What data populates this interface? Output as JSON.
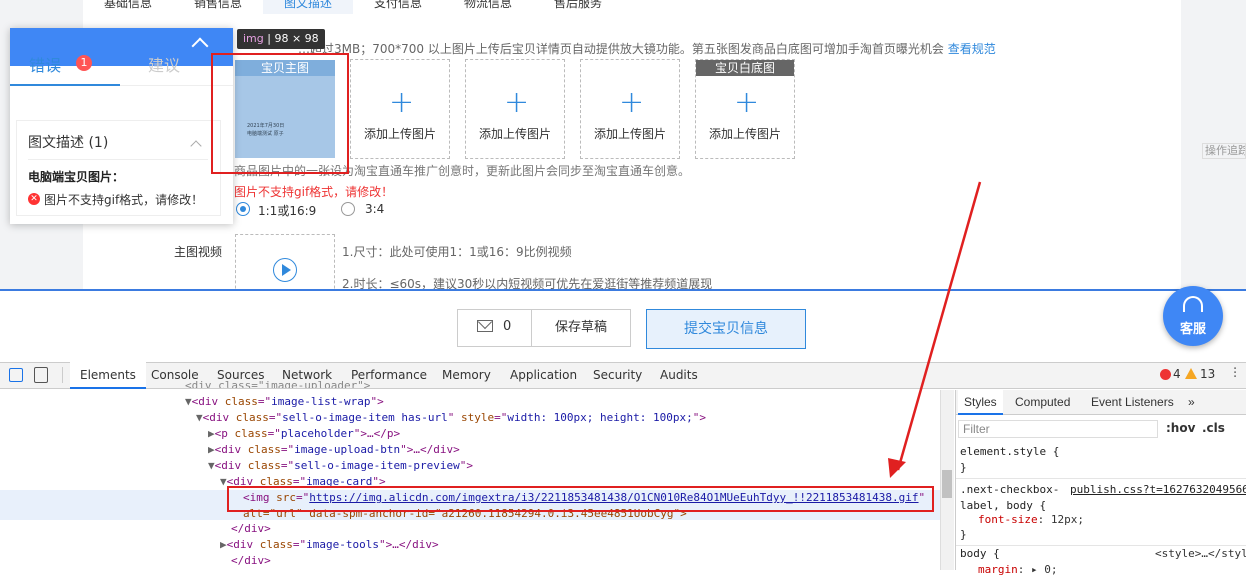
{
  "page": {
    "tabs": [
      "基础信息",
      "销售信息",
      "图文描述",
      "支付信息",
      "物流信息",
      "售后服务"
    ],
    "active_tab": 2,
    "hint_text": "…超过3MB；700*700 以上图片上传后宝贝详情页自动提供放大镜功能。第五张图发商品白底图可增加手淘首页曝光机会",
    "hint_link": "查看规范",
    "tooltip_tag": "img",
    "tooltip_size": "98 × 98",
    "main_image": {
      "tag": "宝贝主图",
      "line1": "2021年7月30日",
      "line2": "电脑端测试 原子"
    },
    "upload_label": "添加上传图片",
    "white_bg_tag": "宝贝白底图",
    "note_text": "商品图片中的一张设为淘宝直通车推广创意时，更新此图片会同步至淘宝直通车创意。",
    "error_text": "图片不支持gif格式，请修改！",
    "ratio_options": [
      "1:1或16:9",
      "3:4"
    ],
    "ratio_selected": 0,
    "video_label": "主图视频",
    "video_tip1": "1.尺寸：此处可使用1：1或16：9比例视频",
    "video_tip2": "2.时长：≤60s，建议30秒以内短视频可优先在爱逛街等推荐频道展现",
    "op_ghost": "操作追踪"
  },
  "panel": {
    "tab_error": "错误",
    "error_count": "1",
    "tab_suggest": "建议",
    "card_title": "图文描述 (1)",
    "card_subtitle": "电脑端宝贝图片：",
    "card_error": "图片不支持gif格式，请修改！"
  },
  "bottom": {
    "mail_count": "0",
    "save_label": "保存草稿",
    "submit_label": "提交宝贝信息",
    "cs_label": "客服"
  },
  "devtools": {
    "tabs": [
      "Elements",
      "Console",
      "Sources",
      "Network",
      "Performance",
      "Memory",
      "Application",
      "Security",
      "Audits"
    ],
    "active_tab": "Elements",
    "error_count": "4",
    "warning_count": "13",
    "code": {
      "l0": "<div class=\"image-uploader\">",
      "l1_tag": "div",
      "l1_attr": "class",
      "l1_val": "image-list-wrap",
      "l2_tag": "div",
      "l2_attr": "class",
      "l2_val": "sell-o-image-item has-url",
      "l2_attr2": "style",
      "l2_val2": "width: 100px; height: 100px;",
      "l3_tag": "p",
      "l3_attr": "class",
      "l3_val": "placeholder",
      "l4_tag": "div",
      "l4_attr": "class",
      "l4_val": "image-upload-btn",
      "l5_tag": "div",
      "l5_attr": "class",
      "l5_val": "sell-o-image-item-preview",
      "l6_tag": "div",
      "l6_attr": "class",
      "l6_val": "image-card",
      "l7_tag": "img",
      "l7_attr": "src",
      "l7_val": "https://img.alicdn.com/imgextra/i3/2211853481438/O1CN010Re84O1MUeEuhTdyy_!!2211853481438.gif",
      "l8_text": "alt=\"url\" data-spm-anchor-id=\"a21260.11854294.0.i3.45ee4851UobCyg\">",
      "l9_tag": "/div",
      "l10_tag": "div",
      "l10_attr": "class",
      "l10_val": "image-tools",
      "l11_tag": "/div"
    },
    "styles_tabs": [
      "Styles",
      "Computed",
      "Event Listeners"
    ],
    "filter_placeholder": "Filter",
    "hov": ":hov",
    "cls": ".cls",
    "rules": {
      "r1_sel": "element.style {",
      "r2_sel": ".next-checkbox-label, body {",
      "r2_src": "publish.css?t=1627632049566",
      "r2_prop": "font-size",
      "r2_val": "12px;",
      "r3_sel": "body {",
      "r3_src": "<style>…</style>",
      "r3_prop": "margin",
      "r3_val": "0;"
    }
  },
  "colors": {
    "accent": "#3089dc",
    "error": "#e02020",
    "panel_head": "#3f87f5"
  }
}
